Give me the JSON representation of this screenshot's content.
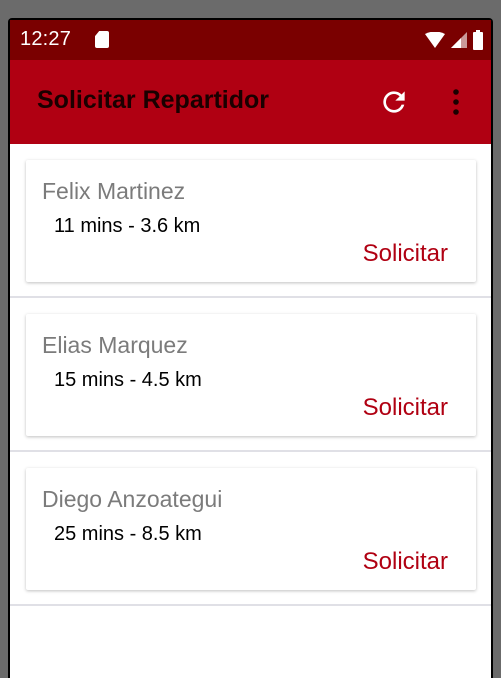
{
  "status_bar": {
    "time": "12:27"
  },
  "app_bar": {
    "title": "Solicitar Repartidor",
    "icons": [
      "refresh-icon",
      "more-vert-icon"
    ]
  },
  "drivers": [
    {
      "name": "Felix Martinez",
      "eta": "11 mins - 3.6 km",
      "action": "Solicitar"
    },
    {
      "name": "Elias Marquez",
      "eta": "15 mins - 4.5 km",
      "action": "Solicitar"
    },
    {
      "name": "Diego Anzoategui",
      "eta": "25 mins - 8.5 km",
      "action": "Solicitar"
    }
  ],
  "colors": {
    "accent": "#b00012",
    "status_bar": "#7a0000",
    "name_text": "#7b7b7b"
  }
}
